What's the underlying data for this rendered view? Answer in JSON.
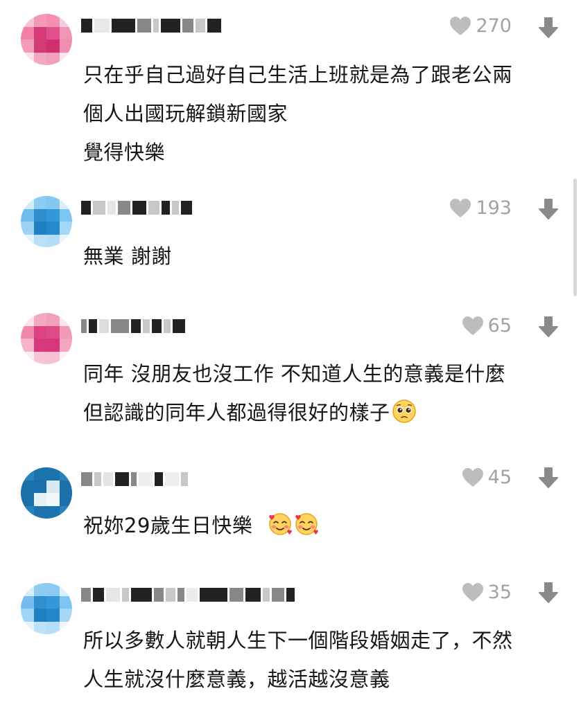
{
  "comments": [
    {
      "likes": "270",
      "lines": [
        "只在乎自己過好自己生活上班就是為了跟老公兩",
        "個人出國玩解鎖新國家",
        "覺得快樂"
      ],
      "avatar_color": "#e8578f"
    },
    {
      "likes": "193",
      "lines": [
        "無業 謝謝"
      ],
      "avatar_color": "#4aa8e0"
    },
    {
      "likes": "65",
      "lines": [
        "同年 沒朋友也沒工作 不知道人生的意義是什麼",
        "但認識的同年人都過得很好的樣子"
      ],
      "emoji": "pleading-face",
      "avatar_color": "#e8578f"
    },
    {
      "likes": "45",
      "lines": [
        "祝妳29歲生日快樂"
      ],
      "emoji": "smiling-face-with-hearts",
      "avatar_color": "#1e6fa8"
    },
    {
      "likes": "35",
      "lines": [
        "所以多數人就朝人生下一個階段婚姻走了，不然",
        "人生就沒什麼意義，越活越沒意義"
      ],
      "avatar_color": "#4aa8e0"
    }
  ],
  "icons": {
    "like": "heart-icon",
    "dislike": "dislike-arrow-icon"
  },
  "colors": {
    "like_count": "#a2a2a2",
    "text": "#161616"
  }
}
